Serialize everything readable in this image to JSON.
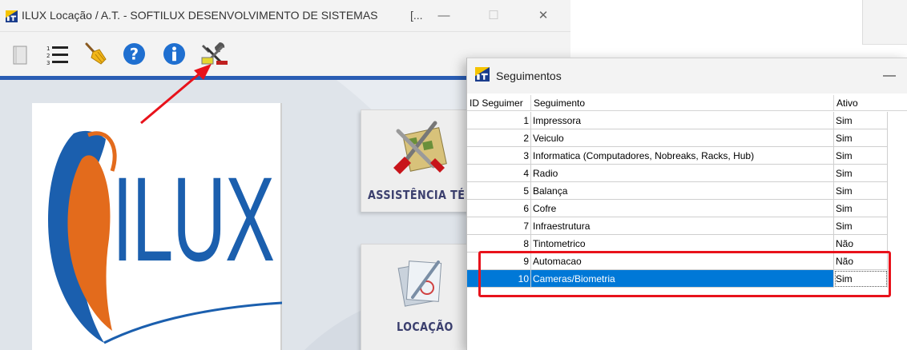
{
  "main_window": {
    "title": "ILUX Locação / A.T. - SOFTILUX DESENVOLVIMENTO DE SISTEMAS",
    "title_overflow": "[...",
    "controls": {
      "minimize": "—",
      "maximize": "☐",
      "close": "✕"
    },
    "toolbar": [
      "blank-icon",
      "list-icon",
      "broom-icon",
      "help-icon",
      "info-icon",
      "tools-icon"
    ],
    "logo_text": "ILUX",
    "tiles": {
      "assistencia_label": "ASSISTÊNCIA TÉ",
      "locacao_label": "LOCAÇÃO"
    }
  },
  "dialog": {
    "title": "Seguimentos",
    "minimize": "—",
    "columns": {
      "id": "ID Seguimer",
      "segmento": "Seguimento",
      "ativo": "Ativo"
    },
    "rows": [
      {
        "id": "1",
        "segmento": "Impressora",
        "ativo": "Sim"
      },
      {
        "id": "2",
        "segmento": "Veiculo",
        "ativo": "Sim"
      },
      {
        "id": "3",
        "segmento": "Informatica (Computadores, Nobreaks, Racks, Hub)",
        "ativo": "Sim"
      },
      {
        "id": "4",
        "segmento": "Radio",
        "ativo": "Sim"
      },
      {
        "id": "5",
        "segmento": "Balança",
        "ativo": "Sim"
      },
      {
        "id": "6",
        "segmento": "Cofre",
        "ativo": "Sim"
      },
      {
        "id": "7",
        "segmento": "Infraestrutura",
        "ativo": "Sim"
      },
      {
        "id": "8",
        "segmento": "Tintometrico",
        "ativo": "Não"
      },
      {
        "id": "9",
        "segmento": "Automacao",
        "ativo": "Não"
      },
      {
        "id": "10",
        "segmento": "Cameras/Biometria",
        "ativo": "Sim"
      }
    ],
    "selected_row": 9
  },
  "colors": {
    "accent_blue": "#2a5db4",
    "selection": "#0078d7",
    "annotation_red": "#e8121b",
    "logo_blue": "#1b5fae",
    "logo_orange": "#e36b1c"
  }
}
